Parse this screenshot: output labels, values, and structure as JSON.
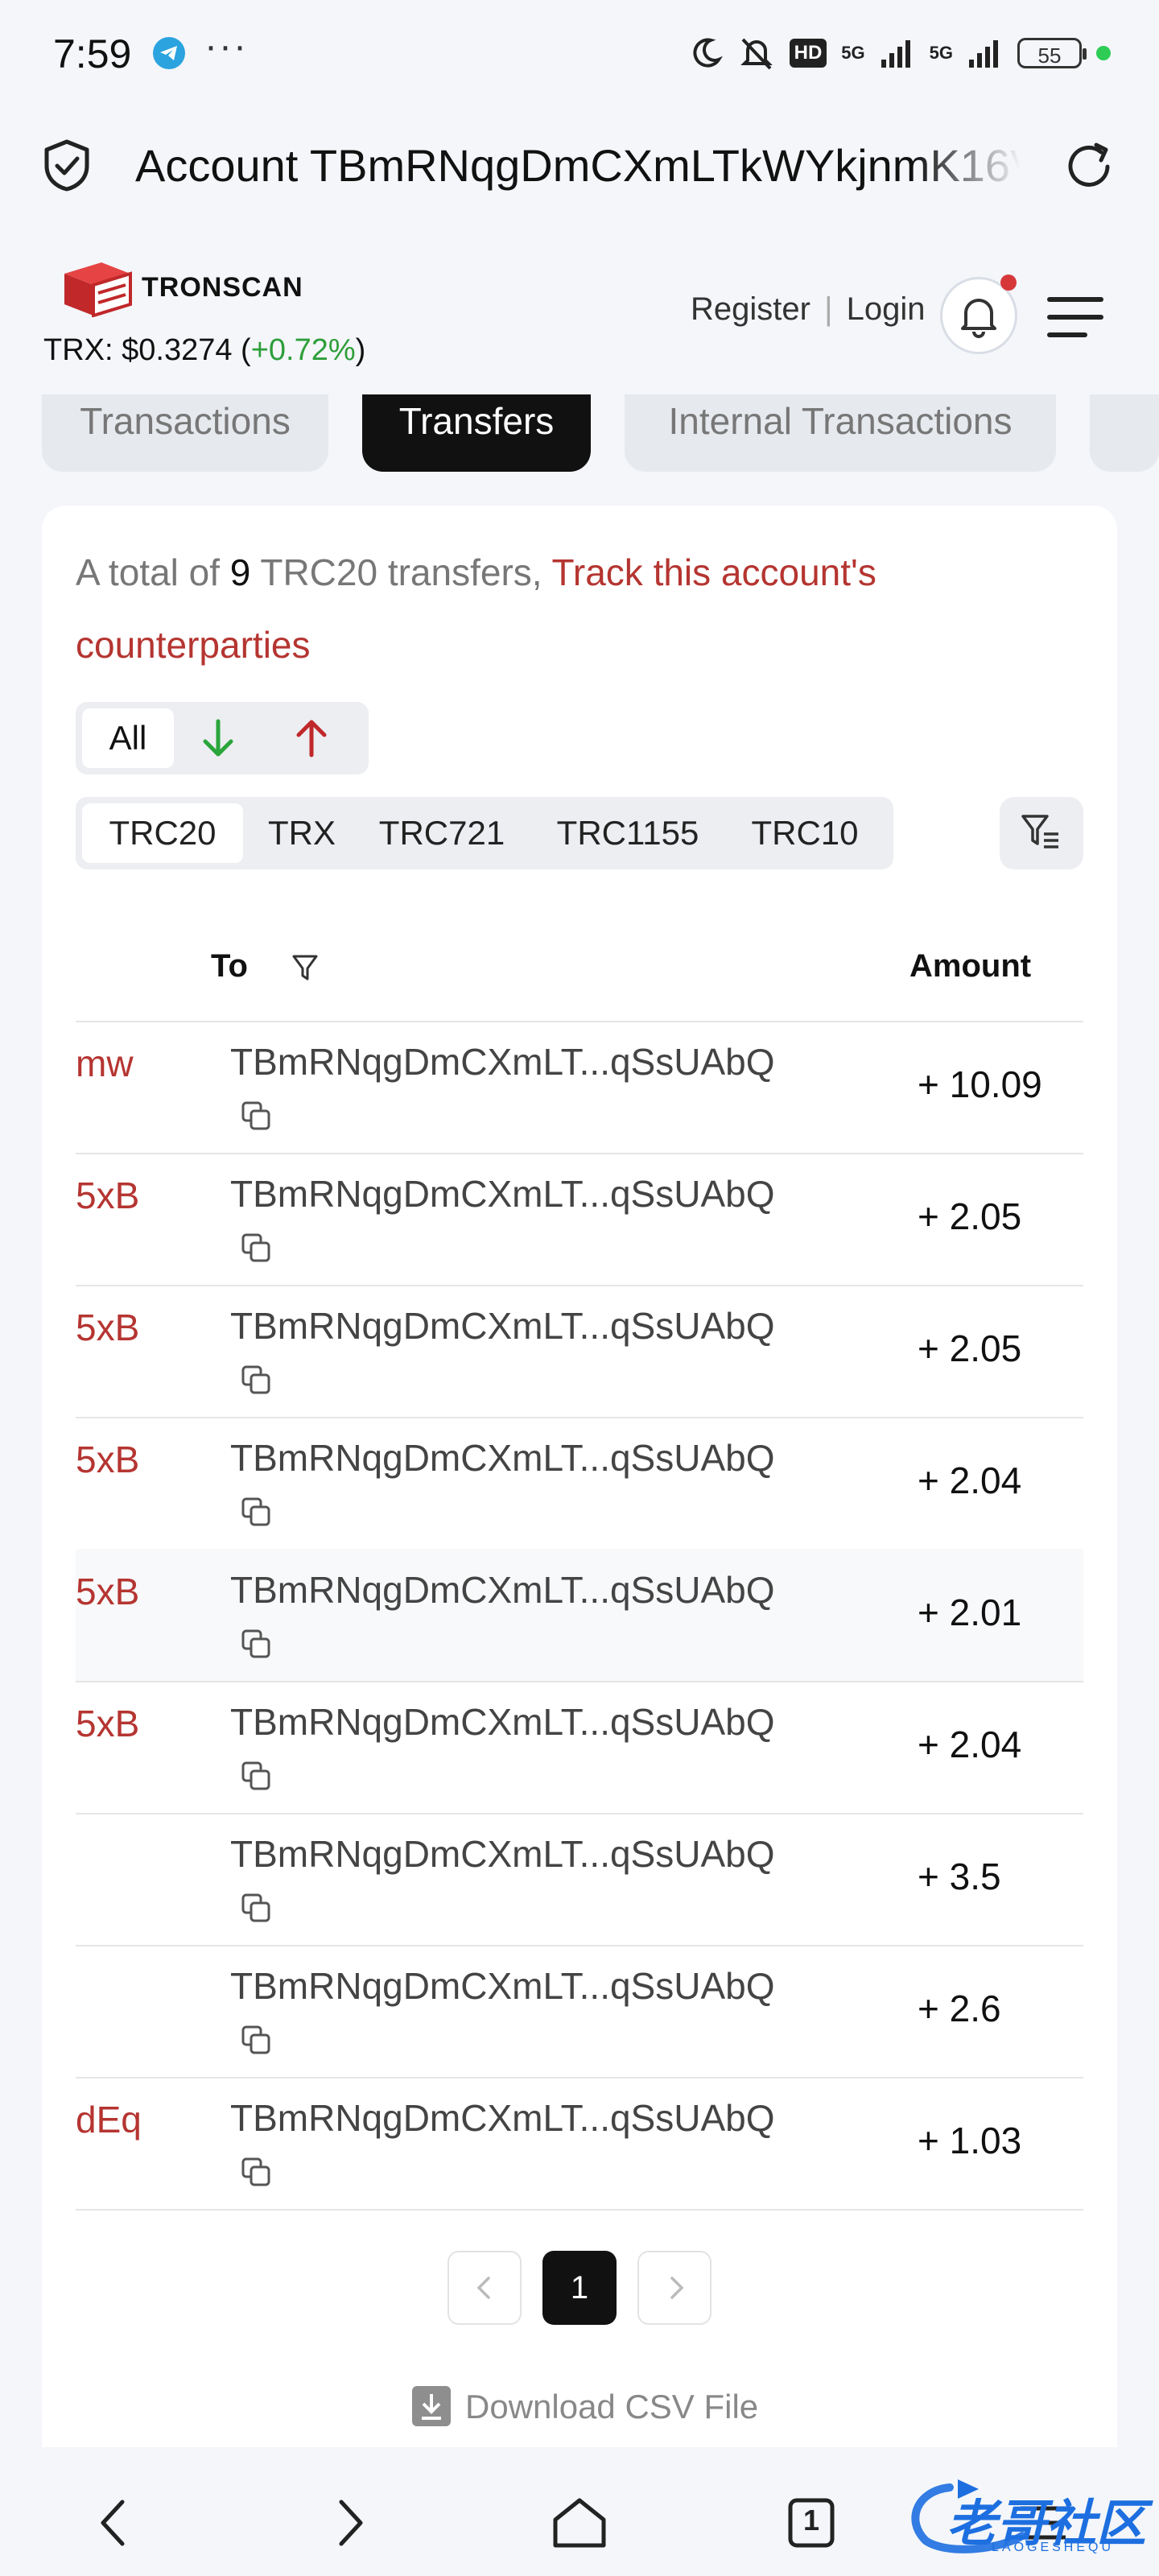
{
  "status_bar": {
    "time": "7:59",
    "more": "···",
    "hd": "HD",
    "net1": "5G",
    "net2": "5G",
    "battery": "55",
    "colors": {
      "telegram": "#2aa3df",
      "dot": "#2ecc55"
    }
  },
  "address_bar": {
    "title": "Account TBmRNqgDmCXmLTkWYkjnmK16V"
  },
  "site": {
    "name": "TRONSCAN",
    "trx_label": "TRX: $0.3274",
    "trx_change_open": "(",
    "trx_change": "+0.72%",
    "trx_change_close": ")",
    "register": "Register",
    "separator": "|",
    "login": "Login"
  },
  "tabs": [
    {
      "label": "Transactions",
      "active": false
    },
    {
      "label": "Transfers",
      "active": true
    },
    {
      "label": "Internal Transactions",
      "active": false
    }
  ],
  "summary": {
    "prefix": "A total of ",
    "count": "9",
    "middle": " TRC20 transfers, ",
    "link": "Track this account's counterparties"
  },
  "direction_filter": {
    "all": "All",
    "in_icon": "arrow-down-icon",
    "out_icon": "arrow-up-icon"
  },
  "token_tabs": [
    "TRC20",
    "TRX",
    "TRC721",
    "TRC1155",
    "TRC10"
  ],
  "table": {
    "columns": {
      "to": "To",
      "amount": "Amount"
    },
    "rows": [
      {
        "from": "mw",
        "to": "TBmRNqgDmCXmLT...qSsUAbQ",
        "amount": "+ 10.09"
      },
      {
        "from": "5xB",
        "to": "TBmRNqgDmCXmLT...qSsUAbQ",
        "amount": "+ 2.05"
      },
      {
        "from": "5xB",
        "to": "TBmRNqgDmCXmLT...qSsUAbQ",
        "amount": "+ 2.05"
      },
      {
        "from": "5xB",
        "to": "TBmRNqgDmCXmLT...qSsUAbQ",
        "amount": "+ 2.04"
      },
      {
        "from": "5xB",
        "to": "TBmRNqgDmCXmLT...qSsUAbQ",
        "amount": "+ 2.01"
      },
      {
        "from": "5xB",
        "to": "TBmRNqgDmCXmLT...qSsUAbQ",
        "amount": "+ 2.04"
      },
      {
        "from": "",
        "to": "TBmRNqgDmCXmLT...qSsUAbQ",
        "amount": "+ 3.5"
      },
      {
        "from": "",
        "to": "TBmRNqgDmCXmLT...qSsUAbQ",
        "amount": "+ 2.6"
      },
      {
        "from": "dEq",
        "to": "TBmRNqgDmCXmLT...qSsUAbQ",
        "amount": "+ 1.03"
      }
    ]
  },
  "pagination": {
    "current": "1"
  },
  "download": {
    "label": "Download CSV File"
  },
  "bottom_nav": {
    "tabs_count": "1"
  },
  "watermark": {
    "text": "老哥社区",
    "sub": "LAOGESHEQU"
  }
}
